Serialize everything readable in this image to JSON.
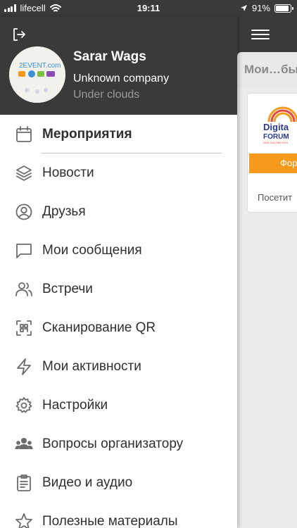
{
  "status": {
    "carrier": "lifecell",
    "time": "19:11",
    "battery": "91%",
    "battery_level": 0.91
  },
  "drawer": {
    "user_name": "Sarar Wags",
    "company": "Unknown company",
    "location": "Under clouds",
    "avatar_text": "2EVENT.com",
    "menu": [
      {
        "label": "Мероприятия",
        "icon": "calendar-icon",
        "active": true
      },
      {
        "label": "Новости",
        "icon": "layers-icon"
      },
      {
        "label": "Друзья",
        "icon": "user-circle-icon"
      },
      {
        "label": "Мои сообщения",
        "icon": "chat-icon"
      },
      {
        "label": "Встречи",
        "icon": "users-icon"
      },
      {
        "label": "Сканирование QR",
        "icon": "qr-scan-icon"
      },
      {
        "label": "Мои активности",
        "icon": "lightning-icon"
      },
      {
        "label": "Настройки",
        "icon": "gear-icon"
      },
      {
        "label": "Вопросы организатору",
        "icon": "group-icon"
      },
      {
        "label": "Видео и аудио",
        "icon": "clipboard-icon"
      },
      {
        "label": "Полезные материалы",
        "icon": "star-icon"
      }
    ]
  },
  "main": {
    "tab_title": "Мои…бы",
    "card_logo_line1": "Digita",
    "card_logo_line2": "FORUM",
    "card_logo_sub": "NUR-SULTAN 2019",
    "card_button": "Фор",
    "card_footer": "Посетит"
  },
  "colors": {
    "header_bg": "#3a3a3a",
    "accent_orange": "#f59a1c",
    "menu_icon": "#6b6b6b"
  }
}
